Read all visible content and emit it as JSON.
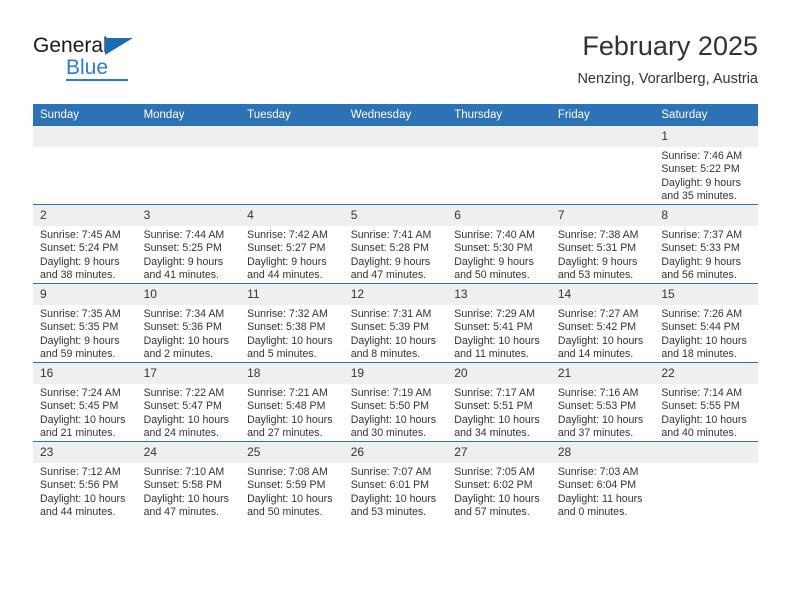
{
  "brand": {
    "name_top": "General",
    "name_bottom": "Blue",
    "accent_color": "#2a7fc9"
  },
  "header": {
    "title": "February 2025",
    "subtitle": "Nenzing, Vorarlberg, Austria"
  },
  "theme": {
    "header_blue": "#2c72b5",
    "daynum_gray": "#efefef",
    "text": "#333333"
  },
  "calendar": {
    "weekday_headers": [
      "Sunday",
      "Monday",
      "Tuesday",
      "Wednesday",
      "Thursday",
      "Friday",
      "Saturday"
    ],
    "weeks": [
      [
        {
          "day": "",
          "line1": "",
          "line2": "",
          "line3": "",
          "line4": ""
        },
        {
          "day": "",
          "line1": "",
          "line2": "",
          "line3": "",
          "line4": ""
        },
        {
          "day": "",
          "line1": "",
          "line2": "",
          "line3": "",
          "line4": ""
        },
        {
          "day": "",
          "line1": "",
          "line2": "",
          "line3": "",
          "line4": ""
        },
        {
          "day": "",
          "line1": "",
          "line2": "",
          "line3": "",
          "line4": ""
        },
        {
          "day": "",
          "line1": "",
          "line2": "",
          "line3": "",
          "line4": ""
        },
        {
          "day": "1",
          "line1": "Sunrise: 7:46 AM",
          "line2": "Sunset: 5:22 PM",
          "line3": "Daylight: 9 hours",
          "line4": "and 35 minutes."
        }
      ],
      [
        {
          "day": "2",
          "line1": "Sunrise: 7:45 AM",
          "line2": "Sunset: 5:24 PM",
          "line3": "Daylight: 9 hours",
          "line4": "and 38 minutes."
        },
        {
          "day": "3",
          "line1": "Sunrise: 7:44 AM",
          "line2": "Sunset: 5:25 PM",
          "line3": "Daylight: 9 hours",
          "line4": "and 41 minutes."
        },
        {
          "day": "4",
          "line1": "Sunrise: 7:42 AM",
          "line2": "Sunset: 5:27 PM",
          "line3": "Daylight: 9 hours",
          "line4": "and 44 minutes."
        },
        {
          "day": "5",
          "line1": "Sunrise: 7:41 AM",
          "line2": "Sunset: 5:28 PM",
          "line3": "Daylight: 9 hours",
          "line4": "and 47 minutes."
        },
        {
          "day": "6",
          "line1": "Sunrise: 7:40 AM",
          "line2": "Sunset: 5:30 PM",
          "line3": "Daylight: 9 hours",
          "line4": "and 50 minutes."
        },
        {
          "day": "7",
          "line1": "Sunrise: 7:38 AM",
          "line2": "Sunset: 5:31 PM",
          "line3": "Daylight: 9 hours",
          "line4": "and 53 minutes."
        },
        {
          "day": "8",
          "line1": "Sunrise: 7:37 AM",
          "line2": "Sunset: 5:33 PM",
          "line3": "Daylight: 9 hours",
          "line4": "and 56 minutes."
        }
      ],
      [
        {
          "day": "9",
          "line1": "Sunrise: 7:35 AM",
          "line2": "Sunset: 5:35 PM",
          "line3": "Daylight: 9 hours",
          "line4": "and 59 minutes."
        },
        {
          "day": "10",
          "line1": "Sunrise: 7:34 AM",
          "line2": "Sunset: 5:36 PM",
          "line3": "Daylight: 10 hours",
          "line4": "and 2 minutes."
        },
        {
          "day": "11",
          "line1": "Sunrise: 7:32 AM",
          "line2": "Sunset: 5:38 PM",
          "line3": "Daylight: 10 hours",
          "line4": "and 5 minutes."
        },
        {
          "day": "12",
          "line1": "Sunrise: 7:31 AM",
          "line2": "Sunset: 5:39 PM",
          "line3": "Daylight: 10 hours",
          "line4": "and 8 minutes."
        },
        {
          "day": "13",
          "line1": "Sunrise: 7:29 AM",
          "line2": "Sunset: 5:41 PM",
          "line3": "Daylight: 10 hours",
          "line4": "and 11 minutes."
        },
        {
          "day": "14",
          "line1": "Sunrise: 7:27 AM",
          "line2": "Sunset: 5:42 PM",
          "line3": "Daylight: 10 hours",
          "line4": "and 14 minutes."
        },
        {
          "day": "15",
          "line1": "Sunrise: 7:26 AM",
          "line2": "Sunset: 5:44 PM",
          "line3": "Daylight: 10 hours",
          "line4": "and 18 minutes."
        }
      ],
      [
        {
          "day": "16",
          "line1": "Sunrise: 7:24 AM",
          "line2": "Sunset: 5:45 PM",
          "line3": "Daylight: 10 hours",
          "line4": "and 21 minutes."
        },
        {
          "day": "17",
          "line1": "Sunrise: 7:22 AM",
          "line2": "Sunset: 5:47 PM",
          "line3": "Daylight: 10 hours",
          "line4": "and 24 minutes."
        },
        {
          "day": "18",
          "line1": "Sunrise: 7:21 AM",
          "line2": "Sunset: 5:48 PM",
          "line3": "Daylight: 10 hours",
          "line4": "and 27 minutes."
        },
        {
          "day": "19",
          "line1": "Sunrise: 7:19 AM",
          "line2": "Sunset: 5:50 PM",
          "line3": "Daylight: 10 hours",
          "line4": "and 30 minutes."
        },
        {
          "day": "20",
          "line1": "Sunrise: 7:17 AM",
          "line2": "Sunset: 5:51 PM",
          "line3": "Daylight: 10 hours",
          "line4": "and 34 minutes."
        },
        {
          "day": "21",
          "line1": "Sunrise: 7:16 AM",
          "line2": "Sunset: 5:53 PM",
          "line3": "Daylight: 10 hours",
          "line4": "and 37 minutes."
        },
        {
          "day": "22",
          "line1": "Sunrise: 7:14 AM",
          "line2": "Sunset: 5:55 PM",
          "line3": "Daylight: 10 hours",
          "line4": "and 40 minutes."
        }
      ],
      [
        {
          "day": "23",
          "line1": "Sunrise: 7:12 AM",
          "line2": "Sunset: 5:56 PM",
          "line3": "Daylight: 10 hours",
          "line4": "and 44 minutes."
        },
        {
          "day": "24",
          "line1": "Sunrise: 7:10 AM",
          "line2": "Sunset: 5:58 PM",
          "line3": "Daylight: 10 hours",
          "line4": "and 47 minutes."
        },
        {
          "day": "25",
          "line1": "Sunrise: 7:08 AM",
          "line2": "Sunset: 5:59 PM",
          "line3": "Daylight: 10 hours",
          "line4": "and 50 minutes."
        },
        {
          "day": "26",
          "line1": "Sunrise: 7:07 AM",
          "line2": "Sunset: 6:01 PM",
          "line3": "Daylight: 10 hours",
          "line4": "and 53 minutes."
        },
        {
          "day": "27",
          "line1": "Sunrise: 7:05 AM",
          "line2": "Sunset: 6:02 PM",
          "line3": "Daylight: 10 hours",
          "line4": "and 57 minutes."
        },
        {
          "day": "28",
          "line1": "Sunrise: 7:03 AM",
          "line2": "Sunset: 6:04 PM",
          "line3": "Daylight: 11 hours",
          "line4": "and 0 minutes."
        },
        {
          "day": "",
          "line1": "",
          "line2": "",
          "line3": "",
          "line4": ""
        }
      ]
    ]
  }
}
